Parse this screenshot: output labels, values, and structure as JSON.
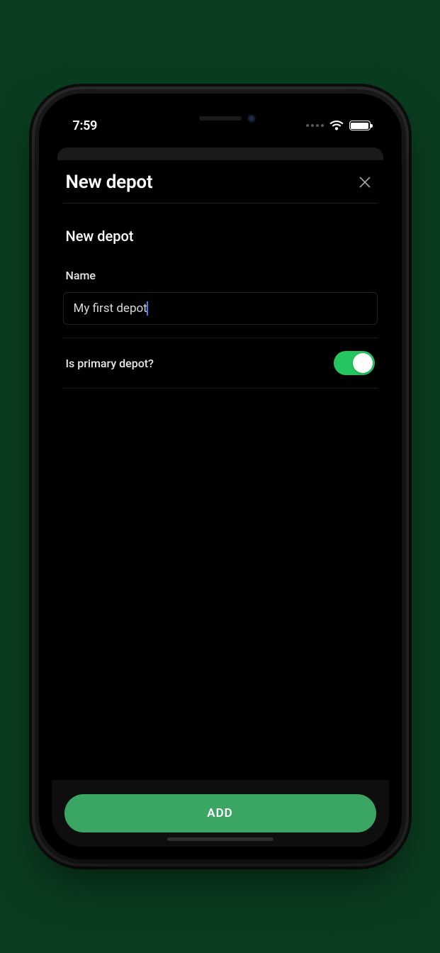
{
  "status": {
    "time": "7:59"
  },
  "sheet": {
    "title": "New depot",
    "section_header": "New depot",
    "name_label": "Name",
    "name_value": "My first depot",
    "toggle_label": "Is primary depot?",
    "toggle_on": true,
    "add_button": "ADD"
  },
  "colors": {
    "accent_green": "#3ba563",
    "switch_green": "#22c55e"
  }
}
